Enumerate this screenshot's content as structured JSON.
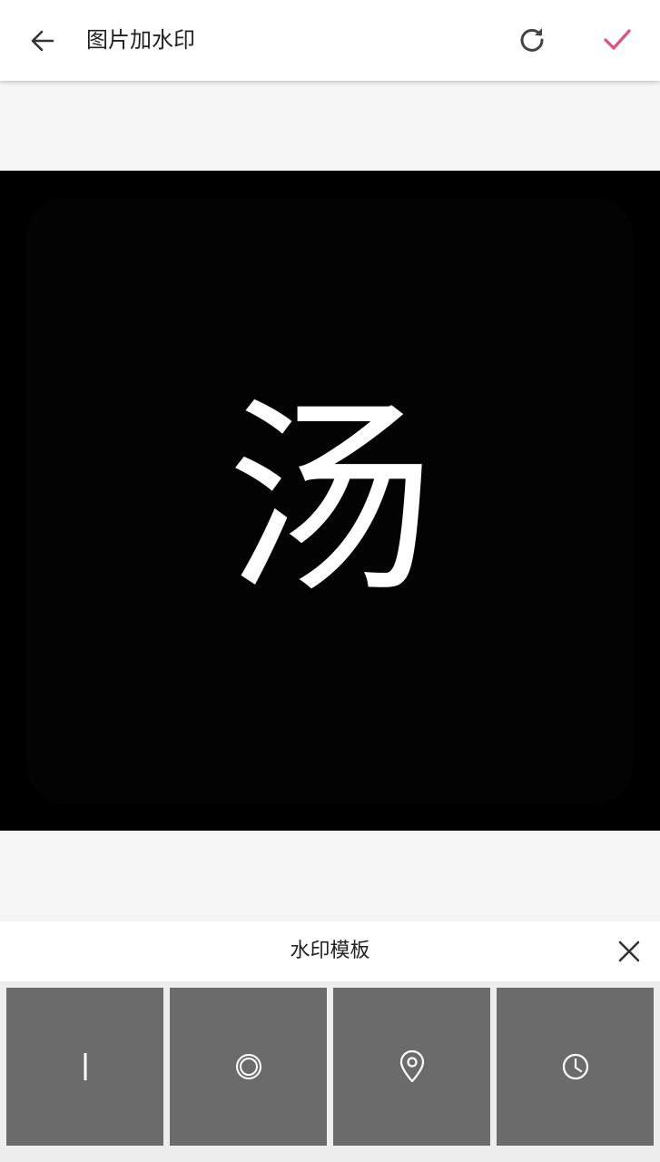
{
  "app_bar": {
    "title": "图片加水印",
    "back_icon": "arrow-left-icon",
    "refresh_icon": "refresh-icon",
    "confirm_icon": "check-icon",
    "confirm_color": "#e0507a"
  },
  "photo": {
    "glyph": "汤",
    "background": "#000000"
  },
  "panel": {
    "title": "水印模板",
    "close_icon": "close-icon",
    "templates": [
      {
        "icon": "text-cursor-icon"
      },
      {
        "icon": "circle-ring-icon"
      },
      {
        "icon": "location-pin-icon"
      },
      {
        "icon": "clock-icon"
      }
    ]
  }
}
